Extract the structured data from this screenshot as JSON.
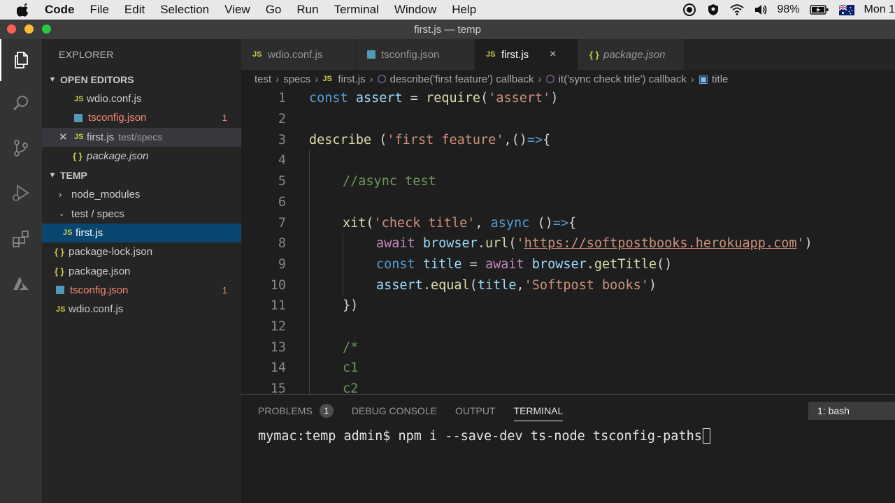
{
  "menubar": {
    "app_name": "Code",
    "items": [
      "File",
      "Edit",
      "Selection",
      "View",
      "Go",
      "Run",
      "Terminal",
      "Window",
      "Help"
    ],
    "battery": "98%",
    "clock": "Mon 1"
  },
  "window": {
    "title": "first.js — temp"
  },
  "sidebar": {
    "title": "EXPLORER",
    "open_editors_label": "OPEN EDITORS",
    "open_editors": [
      {
        "name": "wdio.conf.js",
        "icon": "JS"
      },
      {
        "name": "tsconfig.json",
        "badge": "1"
      },
      {
        "name": "first.js",
        "icon": "JS",
        "path": "test/specs"
      },
      {
        "name": "package.json",
        "icon": "{ }"
      }
    ],
    "folder_label": "TEMP",
    "tree": [
      {
        "name": "node_modules"
      },
      {
        "name": "test / specs"
      },
      {
        "name": "first.js",
        "icon": "JS"
      },
      {
        "name": "package-lock.json",
        "icon": "{ }"
      },
      {
        "name": "package.json",
        "icon": "{ }"
      },
      {
        "name": "tsconfig.json",
        "badge": "1"
      },
      {
        "name": "wdio.conf.js",
        "icon": "JS"
      }
    ]
  },
  "tabs": [
    {
      "label": "wdio.conf.js",
      "icon": "JS"
    },
    {
      "label": "tsconfig.json"
    },
    {
      "label": "first.js",
      "icon": "JS",
      "close": "×"
    },
    {
      "label": "package.json",
      "icon": "{ }"
    }
  ],
  "breadcrumbs": [
    "test",
    "specs",
    "first.js",
    "describe('first feature') callback",
    "it('sync check title') callback",
    "title"
  ],
  "breadcrumb_icon": "JS",
  "editor": {
    "line_numbers": [
      "1",
      "2",
      "3",
      "4",
      "5",
      "6",
      "7",
      "8",
      "9",
      "10",
      "11",
      "12",
      "13",
      "14",
      "15"
    ],
    "lines": {
      "l1": {
        "a": "const",
        "b": " assert",
        "c": " = ",
        "d": "require",
        "e": "(",
        "f": "'assert'",
        "g": ")"
      },
      "l3": {
        "a": "describe",
        "b": " (",
        "c": "'first feature'",
        "d": ",()",
        "e": "=>",
        "f": "{"
      },
      "l5": {
        "a": "//async test"
      },
      "l7": {
        "a": "xit",
        "b": "(",
        "c": "'check title'",
        "d": ", ",
        "e": "async",
        "f": " ()",
        "g": "=>",
        "h": "{"
      },
      "l8": {
        "a": "await",
        "b": " browser",
        "c": ".",
        "d": "url",
        "e": "(",
        "f": "'",
        "g": "https://softpostbooks.herokuapp.com",
        "h": "'",
        "i": ")"
      },
      "l9": {
        "a": "const",
        "b": " title",
        "c": " = ",
        "d": "await",
        "e": " browser",
        "f": ".",
        "g": "getTitle",
        "h": "()"
      },
      "l10": {
        "a": "assert",
        "b": ".",
        "c": "equal",
        "d": "(",
        "e": "title",
        "f": ",",
        "g": "'Softpost books'",
        "h": ")"
      },
      "l11": {
        "a": "})"
      },
      "l13": {
        "a": "/*"
      },
      "l14": {
        "a": "c1"
      },
      "l15": {
        "a": "c2"
      }
    }
  },
  "panel": {
    "tabs": [
      "PROBLEMS",
      "DEBUG CONSOLE",
      "OUTPUT",
      "TERMINAL"
    ],
    "problems_count": "1",
    "active_tab": "TERMINAL",
    "shell": "1: bash",
    "terminal_line": "mymac:temp admin$ npm i --save-dev ts-node tsconfig-paths"
  },
  "colors": {
    "accent": "#094771",
    "error": "#f48771",
    "js_icon": "#cbcb41",
    "ts_icon": "#519aba"
  }
}
